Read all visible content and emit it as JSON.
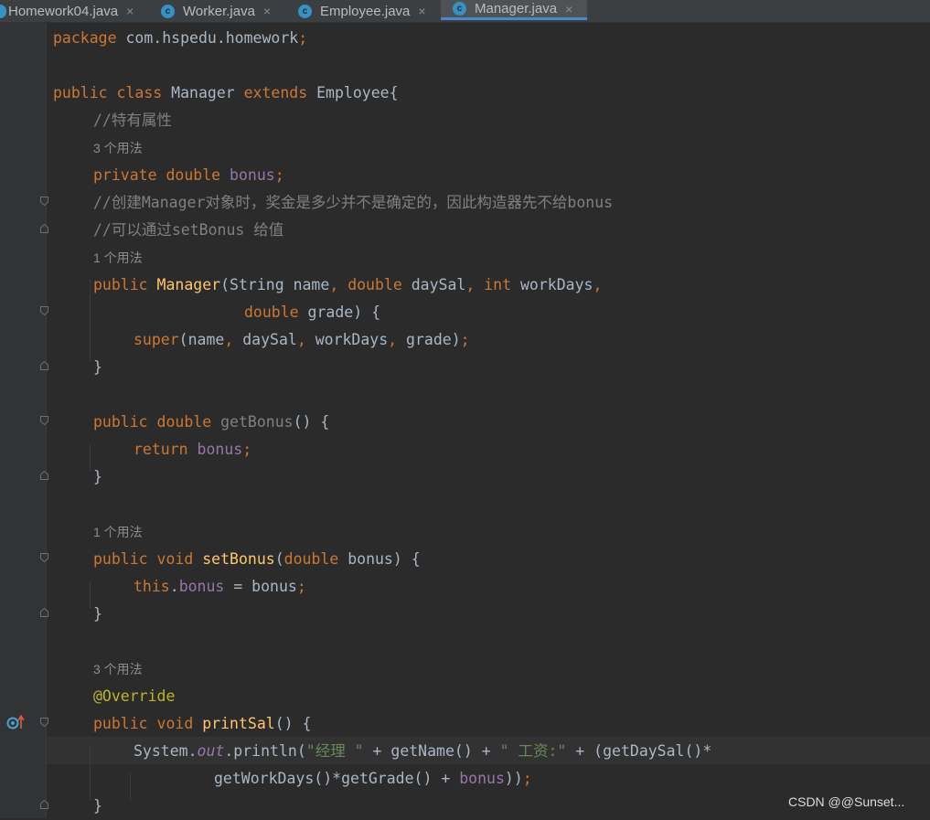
{
  "tabs": [
    {
      "label": "Homework04.java",
      "active": false
    },
    {
      "label": "Worker.java",
      "active": false
    },
    {
      "label": "Employee.java",
      "active": false
    },
    {
      "label": "Manager.java",
      "active": true
    }
  ],
  "close_glyph": "×",
  "class_icon_letter": "c",
  "code": {
    "l1": [
      "package",
      " com.hspedu.homework",
      ";"
    ],
    "l3": [
      "public",
      " ",
      "class",
      " Manager ",
      "extends",
      " Employee{"
    ],
    "l4": "//特有属性",
    "h1": "3 个用法",
    "l5": [
      "private",
      " ",
      "double",
      " ",
      "bonus",
      ";"
    ],
    "l6": "//创建Manager对象时，奖金是多少并不是确定的，因此构造器先不给bonus",
    "l7": "//可以通过setBonus 给值",
    "h2": "1 个用法",
    "l8": [
      "public",
      " ",
      "Manager",
      "(String name",
      ",",
      " ",
      "double",
      " daySal",
      ",",
      " ",
      "int",
      " workDays",
      ","
    ],
    "l9": [
      "double",
      " grade) {"
    ],
    "l10": [
      "super",
      "(name",
      ",",
      " daySal",
      ",",
      " workDays",
      ",",
      " grade)",
      ";"
    ],
    "l11": "}",
    "l13": [
      "public",
      " ",
      "double",
      " ",
      "getBonus",
      "() {"
    ],
    "l14": [
      "return",
      " ",
      "bonus",
      ";"
    ],
    "l15": "}",
    "h3": "1 个用法",
    "l17": [
      "public",
      " ",
      "void",
      " ",
      "setBonus",
      "(",
      "double",
      " bonus) {"
    ],
    "l18": [
      "this",
      ".",
      "bonus",
      " = bonus",
      ";"
    ],
    "l19": "}",
    "h4": "3 个用法",
    "l21": "@Override",
    "l22": [
      "public",
      " ",
      "void",
      " ",
      "printSal",
      "() {"
    ],
    "l23": [
      "System.",
      "out",
      ".println(",
      "\"经理 \"",
      " + getName() + ",
      "\" 工资:\"",
      " + (getDaySal()*"
    ],
    "l24": [
      "getWorkDays()*getGrade() + ",
      "bonus",
      "))",
      ";"
    ],
    "l25": "}"
  },
  "gutter_icons": {
    "override": "override-icon",
    "arrow": "implements-up-arrow-icon"
  },
  "watermark": "CSDN @@Sunset..."
}
